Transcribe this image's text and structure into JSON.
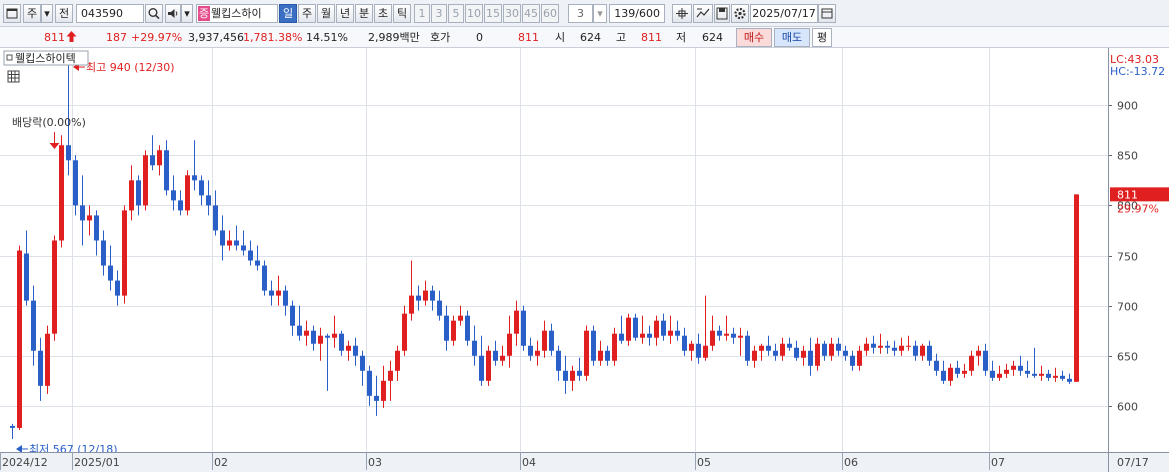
{
  "toolbar": {
    "type_label": "주",
    "period_label": "전",
    "code": "043590",
    "stock_badge": "증",
    "stock_name": "웰킵스하이",
    "tabs": [
      "일",
      "주",
      "월",
      "년",
      "분",
      "초",
      "틱"
    ],
    "active_tab": "일",
    "periods": [
      "1",
      "3",
      "5",
      "10",
      "15",
      "30",
      "45",
      "60"
    ],
    "interval_value": "3",
    "count": "139/600",
    "date": "2025/07/17"
  },
  "quote": {
    "price": "811",
    "change": "187",
    "change_pct": "+29.97%",
    "volume": "3,937,456",
    "volume_pct": "1,781.38%",
    "turnover": "14.51%",
    "amount": "2,989백만",
    "hoga_label": "호가",
    "hoga_value": "0",
    "hoga_price": "811",
    "open_label": "시",
    "open": "624",
    "high_label": "고",
    "high": "811",
    "low_label": "저",
    "low": "624",
    "buy_label": "매수",
    "sell_label": "매도",
    "avg_label": "평"
  },
  "colors": {
    "up": "#e02020",
    "down": "#2a5fc8",
    "grid": "#dde1e8",
    "axis_text": "#444444"
  },
  "chart_data": {
    "type": "candlestick",
    "title": "웰킵스하이텍",
    "ylim": [
      554,
      957
    ],
    "yticks": [
      600,
      650,
      700,
      750,
      800,
      850,
      900
    ],
    "x_month_labels": [
      {
        "label": "2024/12",
        "index": 0
      },
      {
        "label": "2025/01",
        "index": 9
      },
      {
        "label": "02",
        "index": 29
      },
      {
        "label": "03",
        "index": 51
      },
      {
        "label": "04",
        "index": 73
      },
      {
        "label": "05",
        "index": 98
      },
      {
        "label": "06",
        "index": 119
      },
      {
        "label": "07",
        "index": 140
      }
    ],
    "x_end_label": "07/17",
    "lc_label": "LC:43.03",
    "hc_label": "HC:-13.72",
    "last_price_label": "811",
    "last_pct_label": "29.97%",
    "annotations": {
      "high": "최고 940 (12/30)",
      "low": "최저 567 (12/18)",
      "dividend": "배당락(0.00%)"
    },
    "candles": [
      {
        "o": 580,
        "h": 582,
        "l": 567,
        "c": 578
      },
      {
        "o": 578,
        "h": 760,
        "l": 576,
        "c": 755
      },
      {
        "o": 752,
        "h": 775,
        "l": 700,
        "c": 705
      },
      {
        "o": 705,
        "h": 720,
        "l": 640,
        "c": 655
      },
      {
        "o": 655,
        "h": 668,
        "l": 605,
        "c": 620
      },
      {
        "o": 620,
        "h": 680,
        "l": 612,
        "c": 672
      },
      {
        "o": 672,
        "h": 770,
        "l": 665,
        "c": 765
      },
      {
        "o": 765,
        "h": 870,
        "l": 758,
        "c": 860
      },
      {
        "o": 860,
        "h": 940,
        "l": 830,
        "c": 845
      },
      {
        "o": 845,
        "h": 850,
        "l": 790,
        "c": 800
      },
      {
        "o": 800,
        "h": 830,
        "l": 760,
        "c": 785
      },
      {
        "o": 785,
        "h": 800,
        "l": 770,
        "c": 790
      },
      {
        "o": 790,
        "h": 795,
        "l": 750,
        "c": 765
      },
      {
        "o": 765,
        "h": 775,
        "l": 730,
        "c": 740
      },
      {
        "o": 740,
        "h": 760,
        "l": 715,
        "c": 725
      },
      {
        "o": 725,
        "h": 735,
        "l": 700,
        "c": 710
      },
      {
        "o": 710,
        "h": 800,
        "l": 702,
        "c": 795
      },
      {
        "o": 795,
        "h": 840,
        "l": 785,
        "c": 825
      },
      {
        "o": 825,
        "h": 830,
        "l": 790,
        "c": 800
      },
      {
        "o": 800,
        "h": 855,
        "l": 795,
        "c": 850
      },
      {
        "o": 850,
        "h": 870,
        "l": 835,
        "c": 840
      },
      {
        "o": 840,
        "h": 860,
        "l": 830,
        "c": 855
      },
      {
        "o": 855,
        "h": 865,
        "l": 810,
        "c": 815
      },
      {
        "o": 815,
        "h": 830,
        "l": 795,
        "c": 805
      },
      {
        "o": 805,
        "h": 815,
        "l": 790,
        "c": 795
      },
      {
        "o": 795,
        "h": 835,
        "l": 790,
        "c": 830
      },
      {
        "o": 830,
        "h": 865,
        "l": 815,
        "c": 825
      },
      {
        "o": 825,
        "h": 830,
        "l": 800,
        "c": 810
      },
      {
        "o": 810,
        "h": 825,
        "l": 790,
        "c": 800
      },
      {
        "o": 800,
        "h": 815,
        "l": 770,
        "c": 775
      },
      {
        "o": 775,
        "h": 790,
        "l": 745,
        "c": 760
      },
      {
        "o": 760,
        "h": 775,
        "l": 755,
        "c": 765
      },
      {
        "o": 765,
        "h": 780,
        "l": 755,
        "c": 760
      },
      {
        "o": 760,
        "h": 775,
        "l": 750,
        "c": 755
      },
      {
        "o": 755,
        "h": 765,
        "l": 740,
        "c": 745
      },
      {
        "o": 745,
        "h": 760,
        "l": 735,
        "c": 740
      },
      {
        "o": 740,
        "h": 745,
        "l": 710,
        "c": 715
      },
      {
        "o": 715,
        "h": 725,
        "l": 700,
        "c": 710
      },
      {
        "o": 710,
        "h": 730,
        "l": 700,
        "c": 715
      },
      {
        "o": 715,
        "h": 720,
        "l": 690,
        "c": 700
      },
      {
        "o": 700,
        "h": 705,
        "l": 670,
        "c": 680
      },
      {
        "o": 680,
        "h": 700,
        "l": 665,
        "c": 670
      },
      {
        "o": 670,
        "h": 685,
        "l": 660,
        "c": 675
      },
      {
        "o": 675,
        "h": 680,
        "l": 655,
        "c": 662
      },
      {
        "o": 662,
        "h": 678,
        "l": 645,
        "c": 670
      },
      {
        "o": 670,
        "h": 672,
        "l": 615,
        "c": 668
      },
      {
        "o": 668,
        "h": 690,
        "l": 658,
        "c": 672
      },
      {
        "o": 672,
        "h": 675,
        "l": 650,
        "c": 655
      },
      {
        "o": 655,
        "h": 665,
        "l": 645,
        "c": 660
      },
      {
        "o": 660,
        "h": 668,
        "l": 640,
        "c": 650
      },
      {
        "o": 650,
        "h": 655,
        "l": 620,
        "c": 635
      },
      {
        "o": 635,
        "h": 640,
        "l": 600,
        "c": 610
      },
      {
        "o": 610,
        "h": 630,
        "l": 590,
        "c": 605
      },
      {
        "o": 605,
        "h": 640,
        "l": 598,
        "c": 625
      },
      {
        "o": 625,
        "h": 645,
        "l": 605,
        "c": 635
      },
      {
        "o": 635,
        "h": 660,
        "l": 625,
        "c": 655
      },
      {
        "o": 655,
        "h": 700,
        "l": 650,
        "c": 692
      },
      {
        "o": 692,
        "h": 745,
        "l": 685,
        "c": 710
      },
      {
        "o": 710,
        "h": 720,
        "l": 695,
        "c": 705
      },
      {
        "o": 705,
        "h": 725,
        "l": 700,
        "c": 715
      },
      {
        "o": 715,
        "h": 720,
        "l": 695,
        "c": 705
      },
      {
        "o": 705,
        "h": 715,
        "l": 685,
        "c": 690
      },
      {
        "o": 690,
        "h": 700,
        "l": 655,
        "c": 665
      },
      {
        "o": 665,
        "h": 690,
        "l": 660,
        "c": 685
      },
      {
        "o": 685,
        "h": 700,
        "l": 680,
        "c": 690
      },
      {
        "o": 690,
        "h": 695,
        "l": 660,
        "c": 665
      },
      {
        "o": 665,
        "h": 680,
        "l": 640,
        "c": 650
      },
      {
        "o": 650,
        "h": 670,
        "l": 620,
        "c": 625
      },
      {
        "o": 625,
        "h": 660,
        "l": 620,
        "c": 655
      },
      {
        "o": 655,
        "h": 665,
        "l": 640,
        "c": 645
      },
      {
        "o": 645,
        "h": 660,
        "l": 640,
        "c": 650
      },
      {
        "o": 650,
        "h": 690,
        "l": 638,
        "c": 672
      },
      {
        "o": 672,
        "h": 705,
        "l": 660,
        "c": 695
      },
      {
        "o": 695,
        "h": 700,
        "l": 655,
        "c": 660
      },
      {
        "o": 660,
        "h": 668,
        "l": 645,
        "c": 650
      },
      {
        "o": 650,
        "h": 665,
        "l": 640,
        "c": 655
      },
      {
        "o": 655,
        "h": 685,
        "l": 648,
        "c": 675
      },
      {
        "o": 675,
        "h": 682,
        "l": 650,
        "c": 655
      },
      {
        "o": 655,
        "h": 660,
        "l": 625,
        "c": 635
      },
      {
        "o": 635,
        "h": 650,
        "l": 612,
        "c": 625
      },
      {
        "o": 625,
        "h": 640,
        "l": 615,
        "c": 635
      },
      {
        "o": 635,
        "h": 648,
        "l": 625,
        "c": 630
      },
      {
        "o": 630,
        "h": 680,
        "l": 625,
        "c": 675
      },
      {
        "o": 675,
        "h": 680,
        "l": 640,
        "c": 645
      },
      {
        "o": 645,
        "h": 665,
        "l": 640,
        "c": 655
      },
      {
        "o": 655,
        "h": 660,
        "l": 640,
        "c": 645
      },
      {
        "o": 645,
        "h": 678,
        "l": 640,
        "c": 672
      },
      {
        "o": 672,
        "h": 690,
        "l": 662,
        "c": 665
      },
      {
        "o": 665,
        "h": 692,
        "l": 660,
        "c": 688
      },
      {
        "o": 688,
        "h": 692,
        "l": 665,
        "c": 668
      },
      {
        "o": 668,
        "h": 690,
        "l": 662,
        "c": 672
      },
      {
        "o": 672,
        "h": 680,
        "l": 660,
        "c": 668
      },
      {
        "o": 668,
        "h": 690,
        "l": 660,
        "c": 685
      },
      {
        "o": 685,
        "h": 692,
        "l": 665,
        "c": 670
      },
      {
        "o": 670,
        "h": 690,
        "l": 662,
        "c": 675
      },
      {
        "o": 675,
        "h": 685,
        "l": 665,
        "c": 670
      },
      {
        "o": 670,
        "h": 678,
        "l": 650,
        "c": 655
      },
      {
        "o": 655,
        "h": 665,
        "l": 645,
        "c": 662
      },
      {
        "o": 662,
        "h": 672,
        "l": 642,
        "c": 648
      },
      {
        "o": 648,
        "h": 710,
        "l": 645,
        "c": 660
      },
      {
        "o": 660,
        "h": 690,
        "l": 655,
        "c": 675
      },
      {
        "o": 675,
        "h": 680,
        "l": 665,
        "c": 670
      },
      {
        "o": 670,
        "h": 690,
        "l": 665,
        "c": 672
      },
      {
        "o": 672,
        "h": 678,
        "l": 662,
        "c": 668
      },
      {
        "o": 668,
        "h": 678,
        "l": 650,
        "c": 670
      },
      {
        "o": 670,
        "h": 675,
        "l": 640,
        "c": 645
      },
      {
        "o": 645,
        "h": 660,
        "l": 638,
        "c": 655
      },
      {
        "o": 655,
        "h": 662,
        "l": 645,
        "c": 660
      },
      {
        "o": 660,
        "h": 670,
        "l": 650,
        "c": 655
      },
      {
        "o": 655,
        "h": 662,
        "l": 645,
        "c": 650
      },
      {
        "o": 650,
        "h": 668,
        "l": 645,
        "c": 662
      },
      {
        "o": 662,
        "h": 668,
        "l": 655,
        "c": 658
      },
      {
        "o": 658,
        "h": 665,
        "l": 645,
        "c": 648
      },
      {
        "o": 648,
        "h": 660,
        "l": 640,
        "c": 655
      },
      {
        "o": 655,
        "h": 668,
        "l": 630,
        "c": 640
      },
      {
        "o": 640,
        "h": 668,
        "l": 635,
        "c": 662
      },
      {
        "o": 662,
        "h": 665,
        "l": 645,
        "c": 650
      },
      {
        "o": 650,
        "h": 668,
        "l": 645,
        "c": 662
      },
      {
        "o": 662,
        "h": 668,
        "l": 650,
        "c": 655
      },
      {
        "o": 655,
        "h": 660,
        "l": 645,
        "c": 650
      },
      {
        "o": 650,
        "h": 655,
        "l": 635,
        "c": 640
      },
      {
        "o": 640,
        "h": 660,
        "l": 635,
        "c": 655
      },
      {
        "o": 655,
        "h": 668,
        "l": 650,
        "c": 662
      },
      {
        "o": 662,
        "h": 670,
        "l": 652,
        "c": 658
      },
      {
        "o": 658,
        "h": 672,
        "l": 652,
        "c": 660
      },
      {
        "o": 660,
        "h": 665,
        "l": 652,
        "c": 658
      },
      {
        "o": 658,
        "h": 665,
        "l": 650,
        "c": 655
      },
      {
        "o": 655,
        "h": 668,
        "l": 650,
        "c": 660
      },
      {
        "o": 660,
        "h": 670,
        "l": 655,
        "c": 660
      },
      {
        "o": 660,
        "h": 665,
        "l": 645,
        "c": 650
      },
      {
        "o": 650,
        "h": 662,
        "l": 645,
        "c": 660
      },
      {
        "o": 660,
        "h": 665,
        "l": 640,
        "c": 645
      },
      {
        "o": 645,
        "h": 652,
        "l": 630,
        "c": 635
      },
      {
        "o": 635,
        "h": 645,
        "l": 622,
        "c": 625
      },
      {
        "o": 625,
        "h": 642,
        "l": 620,
        "c": 638
      },
      {
        "o": 638,
        "h": 645,
        "l": 628,
        "c": 632
      },
      {
        "o": 632,
        "h": 642,
        "l": 628,
        "c": 635
      },
      {
        "o": 635,
        "h": 655,
        "l": 630,
        "c": 650
      },
      {
        "o": 650,
        "h": 660,
        "l": 640,
        "c": 655
      },
      {
        "o": 655,
        "h": 662,
        "l": 630,
        "c": 635
      },
      {
        "o": 635,
        "h": 645,
        "l": 625,
        "c": 628
      },
      {
        "o": 628,
        "h": 640,
        "l": 625,
        "c": 632
      },
      {
        "o": 632,
        "h": 642,
        "l": 628,
        "c": 636
      },
      {
        "o": 636,
        "h": 645,
        "l": 630,
        "c": 640
      },
      {
        "o": 640,
        "h": 650,
        "l": 630,
        "c": 635
      },
      {
        "o": 635,
        "h": 645,
        "l": 628,
        "c": 632
      },
      {
        "o": 632,
        "h": 658,
        "l": 628,
        "c": 630
      },
      {
        "o": 630,
        "h": 640,
        "l": 625,
        "c": 632
      },
      {
        "o": 632,
        "h": 636,
        "l": 625,
        "c": 628
      },
      {
        "o": 628,
        "h": 638,
        "l": 624,
        "c": 630
      },
      {
        "o": 630,
        "h": 635,
        "l": 625,
        "c": 627
      },
      {
        "o": 627,
        "h": 632,
        "l": 622,
        "c": 624
      },
      {
        "o": 624,
        "h": 811,
        "l": 624,
        "c": 811
      }
    ]
  }
}
